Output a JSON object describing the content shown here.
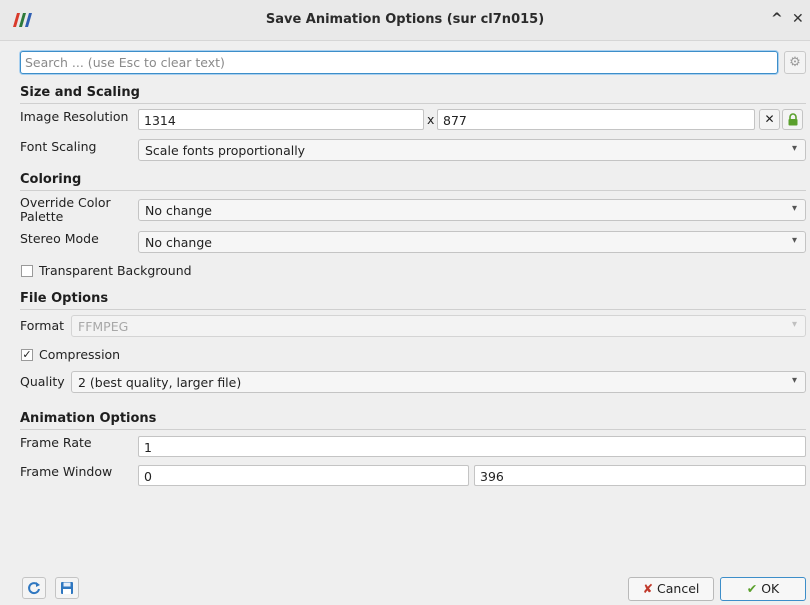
{
  "window": {
    "title": "Save Animation Options (sur cl7n015)",
    "minimize_icon": "^",
    "close_icon": "✕"
  },
  "search": {
    "placeholder": "Search ... (use Esc to clear text)",
    "value": ""
  },
  "sections": {
    "size_scaling": "Size and Scaling",
    "coloring": "Coloring",
    "file_options": "File Options",
    "animation_options": "Animation Options"
  },
  "size_scaling": {
    "resolution_label": "Image Resolution",
    "width": "1314",
    "separator": "x",
    "height": "877",
    "font_scaling_label": "Font Scaling",
    "font_scaling_value": "Scale fonts proportionally"
  },
  "coloring": {
    "override_palette_label": "Override Color Palette",
    "override_palette_value": "No change",
    "stereo_mode_label": "Stereo Mode",
    "stereo_mode_value": "No change",
    "transparent_bg_label": "Transparent Background",
    "transparent_bg_checked": false
  },
  "file_options": {
    "format_label": "Format",
    "format_value": "FFMPEG",
    "compression_label": "Compression",
    "compression_checked": true,
    "quality_label": "Quality",
    "quality_value": "2 (best quality, larger file)"
  },
  "animation": {
    "frame_rate_label": "Frame Rate",
    "frame_rate_value": "1",
    "frame_window_label": "Frame Window",
    "frame_window_start": "0",
    "frame_window_end": "396"
  },
  "footer": {
    "cancel_label": "Cancel",
    "ok_label": "OK"
  },
  "colors": {
    "accent": "#3d8ec9",
    "lock_green": "#5aa02c",
    "reset_blue": "#2f77c0",
    "cancel_red": "#c0392b"
  }
}
